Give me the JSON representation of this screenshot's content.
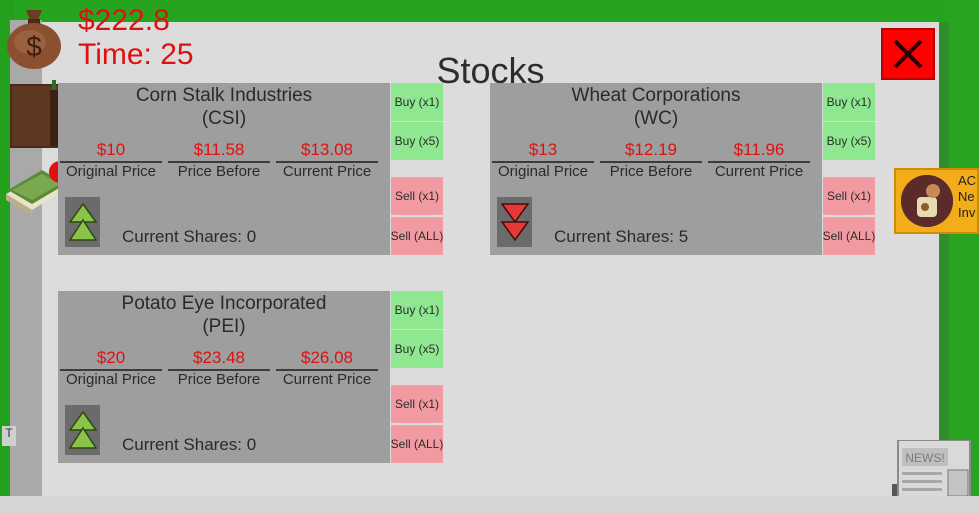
{
  "hud": {
    "money": "$222.8",
    "time": "Time: 25"
  },
  "modal": {
    "title": "Stocks",
    "close_label": "X"
  },
  "labels": {
    "original_price": "Original Price",
    "price_before": "Price Before",
    "current_price": "Current Price"
  },
  "actions": {
    "buy1": "Buy (x1)",
    "buy5": "Buy (x5)",
    "sell1": "Sell (x1)",
    "sellall": "Sell (ALL)"
  },
  "stocks": [
    {
      "name": "Corn Stalk Industries",
      "ticker": "(CSI)",
      "original_price": "$10",
      "price_before": "$11.58",
      "current_price": "$13.08",
      "trend": "up",
      "shares": "Current Shares: 0"
    },
    {
      "name": "Wheat Corporations",
      "ticker": "(WC)",
      "original_price": "$13",
      "price_before": "$12.19",
      "current_price": "$11.96",
      "trend": "down",
      "shares": "Current Shares: 5"
    },
    {
      "name": "Potato Eye Incorporated",
      "ticker": "(PEI)",
      "original_price": "$20",
      "price_before": "$23.48",
      "current_price": "$26.08",
      "trend": "up",
      "shares": "Current Shares: 0"
    }
  ],
  "notification": {
    "line1": "AC",
    "line2": "Ne",
    "line3": "Inv"
  },
  "side_text": "T",
  "news_label": "NEWS!",
  "colors": {
    "buy": "#8fe88f",
    "sell": "#f29aa2",
    "price_red": "#e11010",
    "close_red": "#ff0000",
    "trend_up": "#8bc34a",
    "trend_down": "#e53935"
  }
}
